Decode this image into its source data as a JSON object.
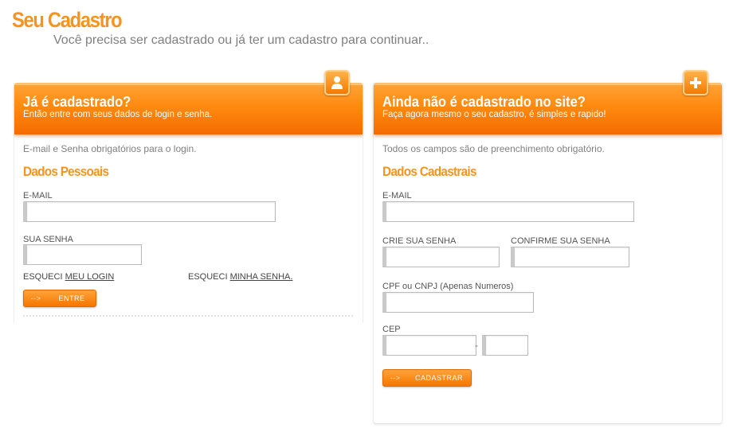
{
  "page": {
    "title": "Seu Cadastro",
    "subtitle": "Você precisa ser cadastrado ou já ter um cadastro para continuar.."
  },
  "login": {
    "header_title": "Já é cadastrado?",
    "header_subtitle": "Então entre com seus dados de login e senha.",
    "icon": "user-icon",
    "note": "E-mail e Senha obrigatórios para o login.",
    "section_title": "Dados Pessoais",
    "email_label": "E-MAIL",
    "email_value": "",
    "password_label": "SUA SENHA",
    "password_value": "",
    "forgot_login_prefix": "ESQUECI ",
    "forgot_login_link": "MEU LOGIN",
    "forgot_password_prefix": "ESQUECI ",
    "forgot_password_link": "MINHA SENHA.",
    "button_arrow": "-->",
    "button_label": "ENTRE"
  },
  "register": {
    "header_title": "Ainda não é cadastrado no site?",
    "header_subtitle": "Faça agora mesmo o seu cadastro, é simples e rapido!",
    "icon": "plus-icon",
    "note": "Todos os campos são de preenchimento obrigatório.",
    "section_title": "Dados Cadastrais",
    "email_label": "E-MAIL",
    "email_value": "",
    "password_label": "CRIE SUA SENHA",
    "password_value": "",
    "confirm_label": "CONFIRME SUA SENHA",
    "confirm_value": "",
    "cpf_label": "CPF ou CNPJ  (Apenas Numeros)",
    "cpf_value": "",
    "cep_label": "CEP",
    "cep_value_1": "",
    "cep_separator": "-",
    "cep_value_2": "",
    "button_arrow": "-->",
    "button_label": "CADASTRAR"
  },
  "colors": {
    "accent": "#f7941d",
    "header_orange": "#ff8a10"
  }
}
